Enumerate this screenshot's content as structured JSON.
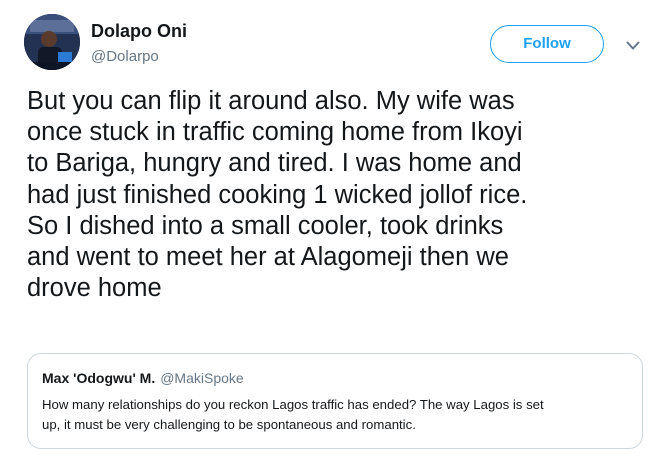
{
  "author": {
    "name": "Dolapo Oni",
    "handle": "@Dolarpo",
    "avatar_icon": "profile-photo"
  },
  "follow_button": {
    "label": "Follow",
    "color": "#1da1f2"
  },
  "menu_icon": "chevron-down-icon",
  "tweet": {
    "lines": [
      "But you can flip it around also. My wife was",
      "once stuck in traffic coming home from Ikoyi",
      "to Bariga, hungry and tired. I was home and",
      "had just finished cooking 1 wicked jollof rice.",
      "So I dished into a small cooler, took drinks",
      "and went to meet her at Alagomeji then we",
      "drove home"
    ]
  },
  "quoted_tweet": {
    "author_name": "Max 'Odogwu' M.",
    "author_handle": "@MakiSpoke",
    "lines": [
      "How many relationships do you reckon Lagos traffic has ended? The way Lagos is set",
      "up, it must be very challenging to be spontaneous and romantic."
    ]
  }
}
